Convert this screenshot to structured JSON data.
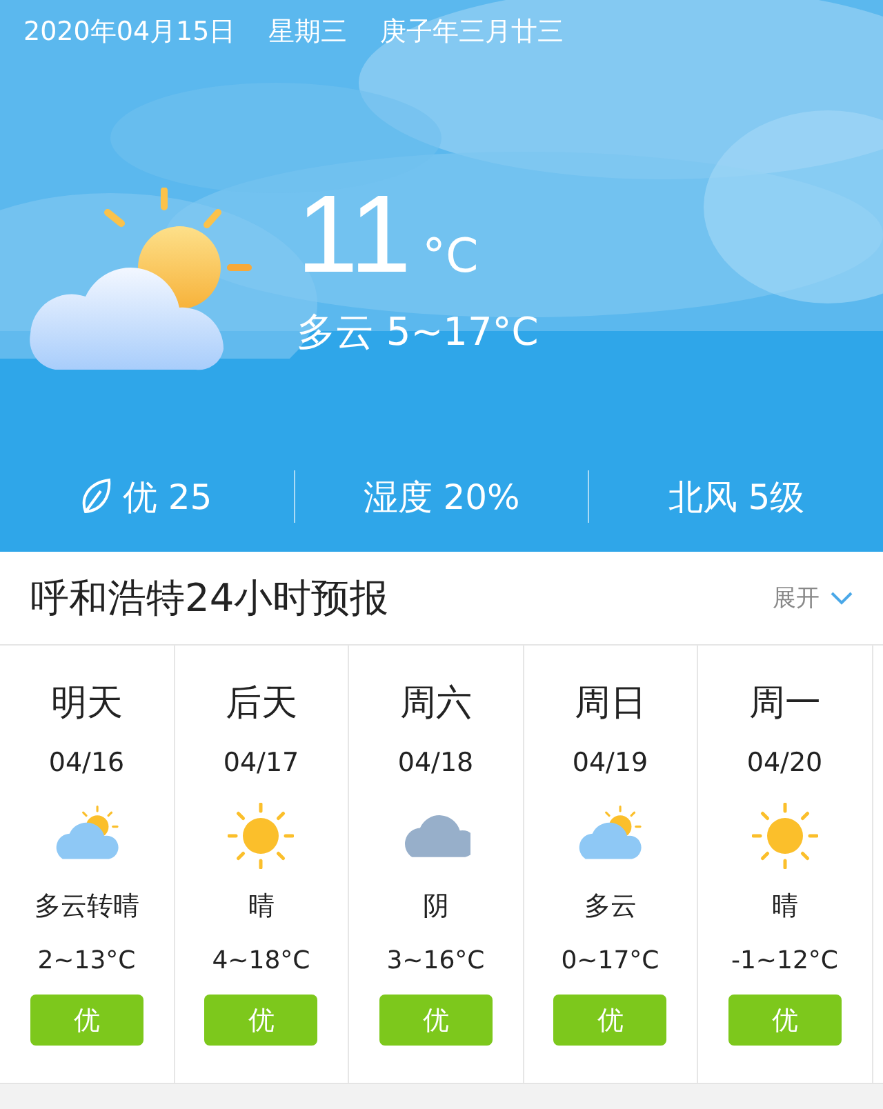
{
  "date_line": {
    "date": "2020年04月15日",
    "weekday": "星期三",
    "lunar": "庚子年三月廿三"
  },
  "current": {
    "kind": "partly_cloudy",
    "temperature": "11",
    "unit": "°C",
    "summary": "多云 5~17°C"
  },
  "stats": [
    {
      "kind": "air",
      "text": "优 25"
    },
    {
      "kind": "plain",
      "text": "湿度 20%"
    },
    {
      "kind": "plain",
      "text": "北风 5级"
    }
  ],
  "forecast_header": {
    "title": "呼和浩特24小时预报",
    "toggle": "展开"
  },
  "days": [
    {
      "day": "明天",
      "date": "04/16",
      "kind": "partly_cloudy",
      "condition": "多云转晴",
      "range": "2~13°C",
      "aqi": "优"
    },
    {
      "day": "后天",
      "date": "04/17",
      "kind": "sunny",
      "condition": "晴",
      "range": "4~18°C",
      "aqi": "优"
    },
    {
      "day": "周六",
      "date": "04/18",
      "kind": "overcast",
      "condition": "阴",
      "range": "3~16°C",
      "aqi": "优"
    },
    {
      "day": "周日",
      "date": "04/19",
      "kind": "partly_cloudy",
      "condition": "多云",
      "range": "0~17°C",
      "aqi": "优"
    },
    {
      "day": "周一",
      "date": "04/20",
      "kind": "sunny",
      "condition": "晴",
      "range": "-1~12°C",
      "aqi": "优"
    }
  ]
}
